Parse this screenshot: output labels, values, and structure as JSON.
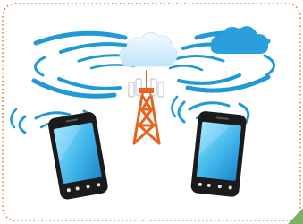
{
  "colors": {
    "frame_border": "#e07a2c",
    "frame_fill": "#ffffff",
    "signal_wave": "#1f9ad6",
    "cloud": "#d9eef8",
    "cloud_bright": "#2a9fdc",
    "tower": "#e8641e",
    "phone_body": "#1b1b1b",
    "phone_screen": "#4fc3ef",
    "corner_leaf": "#7fae6b"
  },
  "icons": {
    "tower": "cell-tower-icon",
    "phone_left": "smartphone-icon",
    "phone_right": "smartphone-icon",
    "cloud_center": "cloud-icon",
    "cloud_right": "cloud-icon"
  }
}
